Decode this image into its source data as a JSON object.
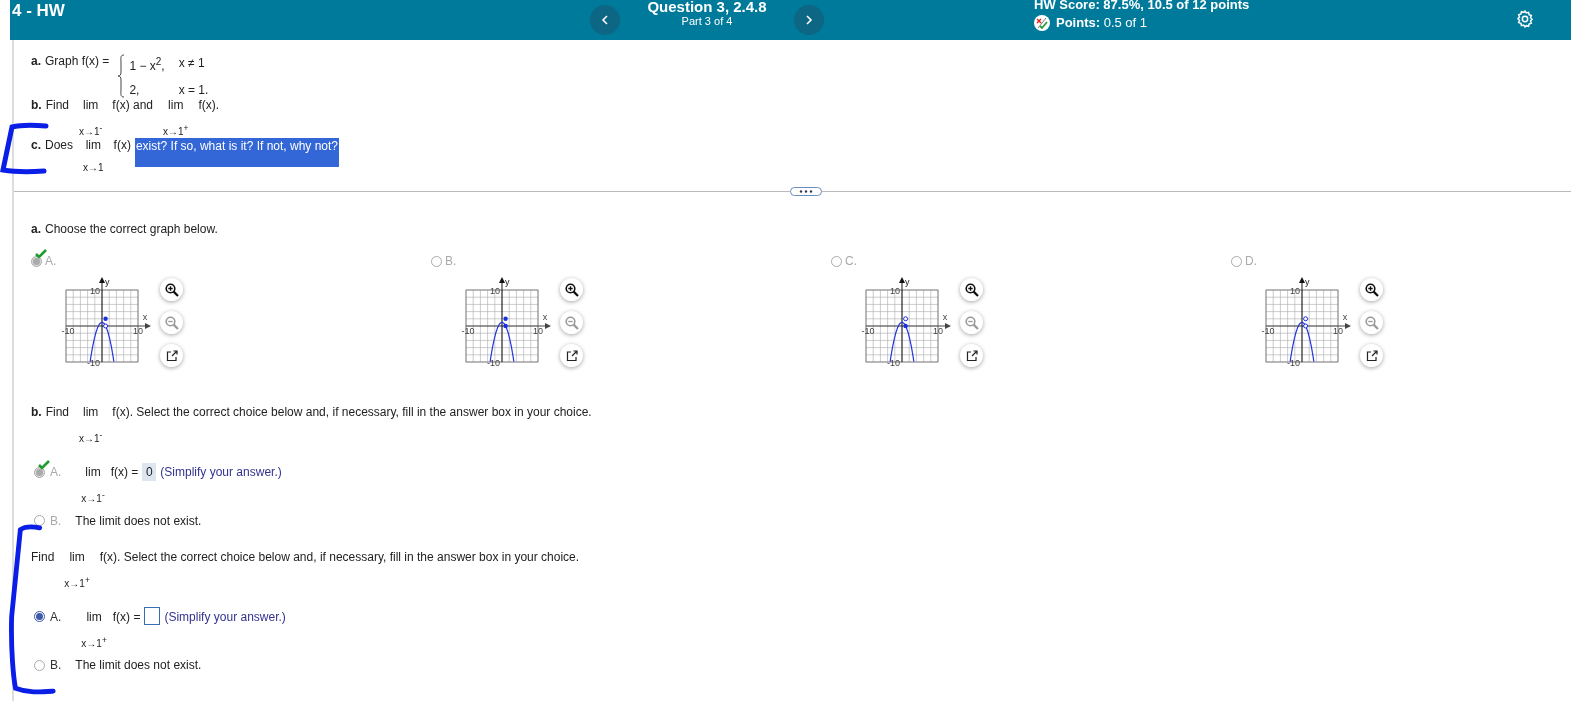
{
  "header": {
    "course": "4 - HW",
    "question": "Question 3, 2.4.8",
    "part": "Part 3 of 4",
    "score": "HW Score: 87.5%, 10.5 of 12 points",
    "points_label": "Points:",
    "points": "0.5 of 1"
  },
  "prompt": [
    {
      "label": "a.",
      "segments": [
        {
          "kind": "text",
          "text": "Graph f(x) ="
        },
        {
          "kind": "piecewise",
          "rows": [
            {
              "expr": "1 − x$^{2}$,",
              "cond": "x ≠ 1"
            },
            {
              "expr": "2,",
              "cond": "x = 1."
            }
          ]
        }
      ]
    },
    {
      "label": "b.",
      "segments": [
        {
          "kind": "text",
          "text": "Find"
        },
        {
          "kind": "lim",
          "lim": "lim",
          "under": "x→1$^{-}$"
        },
        {
          "kind": "text",
          "text": "f(x) and"
        },
        {
          "kind": "lim",
          "lim": "lim",
          "under": "x→1$^{+}$"
        },
        {
          "kind": "text",
          "text": "f(x)."
        }
      ]
    },
    {
      "label": "c.",
      "segments": [
        {
          "kind": "text",
          "text": "Does"
        },
        {
          "kind": "lim",
          "lim": "lim",
          "under": "x→1"
        },
        {
          "kind": "text",
          "text": "f(x)"
        },
        {
          "kind": "text",
          "text": "exist? If so, what is it? If not, why not?",
          "highlighted": true
        }
      ]
    }
  ],
  "parts": [
    {
      "label": "a.",
      "kind": "graphs",
      "locked": true,
      "segments": [
        {
          "kind": "text",
          "text": "Choose the correct graph below."
        }
      ],
      "options": [
        {
          "letter": "A.",
          "selected": true,
          "correct": true,
          "graph": {
            "y_label": "y",
            "x_label": "x",
            "y_max": "10",
            "x_min": "-10",
            "x_max": "10",
            "y_min": "-10",
            "upper_point_filled": true,
            "lower_point_filled": false
          }
        },
        {
          "letter": "B.",
          "selected": false,
          "correct": false,
          "graph": {
            "y_label": "y",
            "x_label": "x",
            "y_max": "10",
            "x_min": "-10",
            "x_max": "10",
            "y_min": "-10",
            "upper_point_filled": true,
            "lower_point_filled": true
          }
        },
        {
          "letter": "C.",
          "selected": false,
          "correct": false,
          "graph": {
            "y_label": "y",
            "x_label": "x",
            "y_max": "10",
            "x_min": "-10",
            "x_max": "10",
            "y_min": "-10",
            "upper_point_filled": false,
            "lower_point_filled": true
          }
        },
        {
          "letter": "D.",
          "selected": false,
          "correct": false,
          "graph": {
            "y_label": "y",
            "x_label": "x",
            "y_max": "10",
            "x_min": "-10",
            "x_max": "10",
            "y_min": "-10",
            "upper_point_filled": false,
            "lower_point_filled": false
          }
        }
      ]
    },
    {
      "label": "b.",
      "kind": "choices",
      "locked": true,
      "segments": [
        {
          "kind": "text",
          "text": "Find"
        },
        {
          "kind": "lim",
          "lim": "lim",
          "under": "x→1$^{-}$"
        },
        {
          "kind": "text",
          "text": "f(x). Select the correct choice below and, if necessary, fill in the answer box in your choice."
        }
      ],
      "options": [
        {
          "letter": "A.",
          "kind": "answer",
          "selected": true,
          "correct": true,
          "lim": "lim",
          "under": "x→1$^{-}$",
          "expr": "f(x) =",
          "value": "0",
          "hint": "(Simplify your answer.)"
        },
        {
          "letter": "B.",
          "kind": "text",
          "selected": false,
          "correct": false,
          "text": "The limit does not exist."
        }
      ]
    },
    {
      "kind": "choices",
      "locked": false,
      "segments": [
        {
          "kind": "text",
          "text": "Find"
        },
        {
          "kind": "lim",
          "lim": "lim",
          "under": "x→1$^{+}$"
        },
        {
          "kind": "text",
          "text": "f(x). Select the correct choice below and, if necessary, fill in the answer box in your choice."
        }
      ],
      "options": [
        {
          "letter": "A.",
          "kind": "answer",
          "selected": true,
          "correct": false,
          "lim": "lim",
          "under": "x→1$^{+}$",
          "expr": "f(x) =",
          "hint": "(Simplify your answer.)"
        },
        {
          "letter": "B.",
          "kind": "text",
          "selected": false,
          "correct": false,
          "text": "The limit does not exist."
        }
      ]
    }
  ]
}
